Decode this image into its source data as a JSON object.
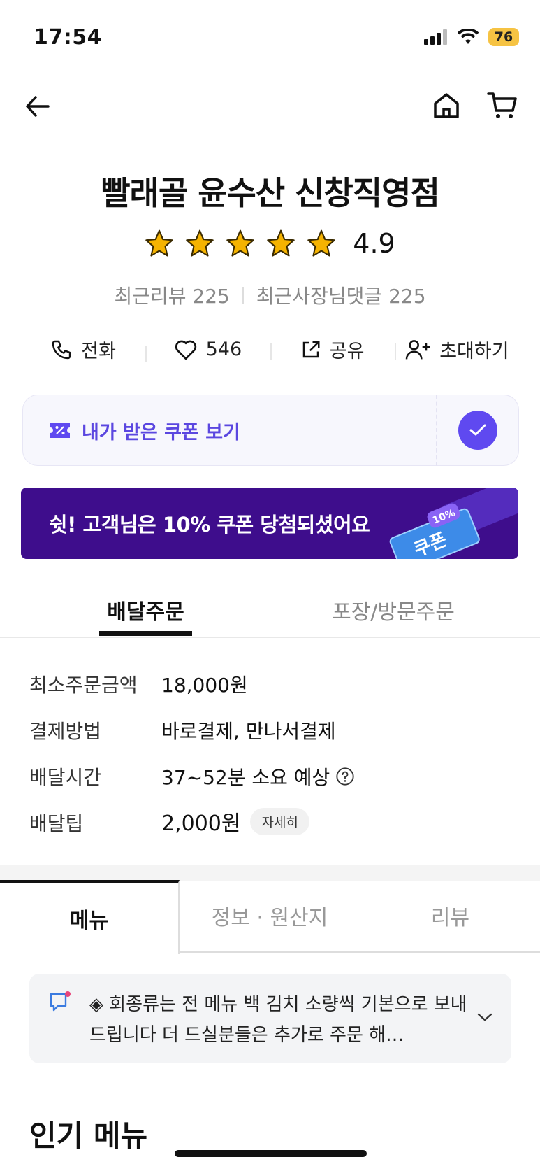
{
  "status_bar": {
    "time": "17:54",
    "battery": "76"
  },
  "store": {
    "name": "빨래골 윤수산 신창직영점",
    "rating": "4.9",
    "recent_reviews": "최근리뷰 225",
    "recent_owner_replies": "최근사장님댓글 225"
  },
  "actions": {
    "call": "전화",
    "likes": "546",
    "share": "공유",
    "invite": "초대하기"
  },
  "coupon": {
    "label": "내가 받은 쿠폰 보기"
  },
  "banner": {
    "text": "쉿! 고객님은 10% 쿠폰 당첨되셨어요",
    "ticket_text": "쿠폰",
    "ticket_badge": "10%"
  },
  "order_tabs": {
    "delivery": "배달주문",
    "pickup": "포장/방문주문"
  },
  "info": {
    "min_order_label": "최소주문금액",
    "min_order_value": "18,000원",
    "payment_label": "결제방법",
    "payment_value": "바로결제, 만나서결제",
    "time_label": "배달시간",
    "time_value": "37~52분 소요 예상",
    "tip_label": "배달팁",
    "tip_value": "2,000원",
    "tip_detail": "자세히"
  },
  "menu_tabs": {
    "menu": "메뉴",
    "info": "정보 · 원산지",
    "review": "리뷰"
  },
  "notice": {
    "text": "◈ 회종류는 전 메뉴 백 김치 소량씩 기본으로 보내드립니다 더 드실분들은 추가로 주문 해…"
  },
  "sections": {
    "popular": "인기 메뉴"
  },
  "colors": {
    "accent": "#5f49f0",
    "banner_bg": "#3e0d8c",
    "star": "#f5b301"
  }
}
